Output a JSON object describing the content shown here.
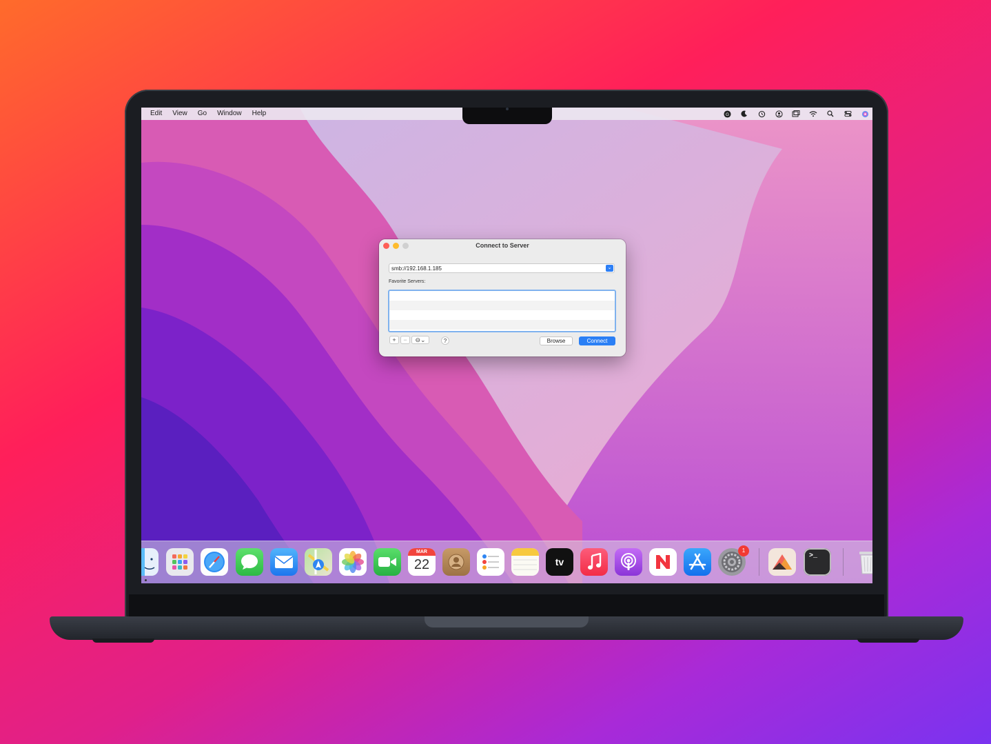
{
  "menubar": {
    "items": [
      "Edit",
      "View",
      "Go",
      "Window",
      "Help"
    ],
    "status_icons": [
      "grammarly-icon",
      "moon-icon",
      "time-machine-icon",
      "user-icon",
      "window-icon",
      "wifi-icon",
      "search-icon",
      "control-center-icon",
      "siri-icon"
    ]
  },
  "dialog": {
    "title": "Connect to Server",
    "server_address": "smb://192.168.1.185",
    "favorites_label": "Favorite Servers:",
    "add_label": "+",
    "remove_label": "−",
    "options_label": "⊖⌄",
    "help_label": "?",
    "browse_label": "Browse",
    "connect_label": "Connect"
  },
  "dock": {
    "apps": [
      {
        "name": "Finder",
        "icon": "finder-icon",
        "color": "#39a2f5"
      },
      {
        "name": "Launchpad",
        "icon": "launchpad-icon",
        "color": "#e7e7ea"
      },
      {
        "name": "Safari",
        "icon": "safari-icon",
        "color": "#ffffff"
      },
      {
        "name": "Messages",
        "icon": "messages-icon",
        "color": "#35c94b"
      },
      {
        "name": "Mail",
        "icon": "mail-icon",
        "color": "#2f8bf0"
      },
      {
        "name": "Maps",
        "icon": "maps-icon",
        "color": "#a7d98a"
      },
      {
        "name": "Photos",
        "icon": "photos-icon",
        "color": "#ffffff"
      },
      {
        "name": "FaceTime",
        "icon": "facetime-icon",
        "color": "#33c14f"
      },
      {
        "name": "Calendar",
        "icon": "calendar-icon",
        "color": "#ffffff"
      },
      {
        "name": "Contacts",
        "icon": "contacts-icon",
        "color": "#b5895a"
      },
      {
        "name": "Reminders",
        "icon": "reminders-icon",
        "color": "#ffffff"
      },
      {
        "name": "Notes",
        "icon": "notes-icon",
        "color": "#fbfaf4"
      },
      {
        "name": "TV",
        "icon": "tv-icon",
        "color": "#111111"
      },
      {
        "name": "Music",
        "icon": "music-icon",
        "color": "#fb3b55"
      },
      {
        "name": "Podcasts",
        "icon": "podcasts-icon",
        "color": "#a14ce3"
      },
      {
        "name": "News",
        "icon": "news-icon",
        "color": "#ffffff"
      },
      {
        "name": "App Store",
        "icon": "app-store-icon",
        "color": "#1f8cf6"
      },
      {
        "name": "System Preferences",
        "icon": "system-preferences-icon",
        "color": "#8d8d92"
      },
      {
        "name": "Affinity",
        "icon": "affinity-icon",
        "color": "#f3e6dc"
      },
      {
        "name": "Terminal",
        "icon": "terminal-icon",
        "color": "#1b1b1b"
      },
      {
        "name": "Trash",
        "icon": "trash-icon",
        "color": "#e8e8ea"
      }
    ],
    "calendar_month": "MAR",
    "calendar_day": "22",
    "tv_label": "tv",
    "terminal_prompt": ">_",
    "system_prefs_badge": "1"
  }
}
